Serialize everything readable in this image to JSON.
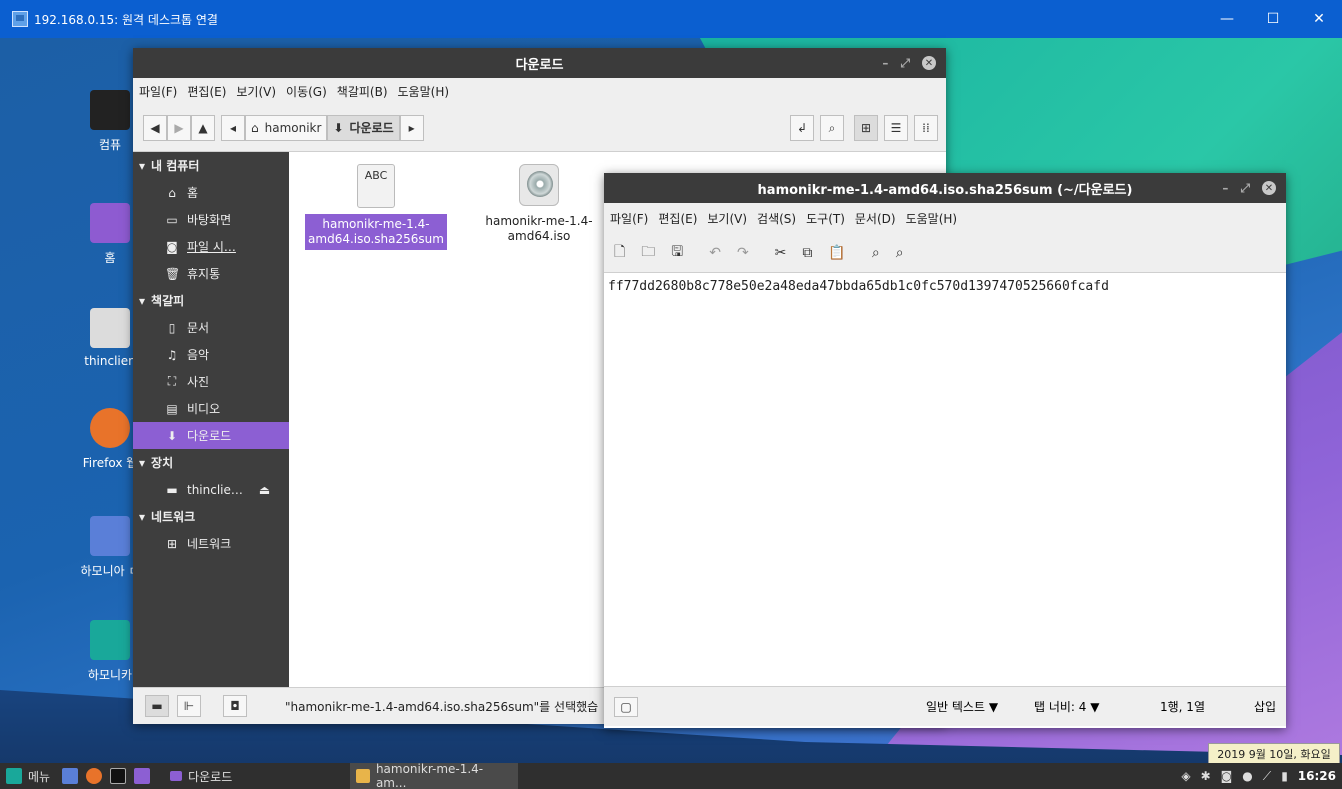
{
  "rdp": {
    "title": "192.168.0.15: 원격 데스크톱 연결",
    "min": "—",
    "max": "☐",
    "close": "✕"
  },
  "desktop_icons": [
    {
      "label": "컴퓨",
      "color": "#222"
    },
    {
      "label": "홈",
      "color": "#8e5bd1"
    },
    {
      "label": "thinclien",
      "color": "#dcdcdc"
    },
    {
      "label": "Firefox 웹",
      "color": "#e8732a"
    },
    {
      "label": "하모니아 ㅁ",
      "color": "#5a7fd8"
    },
    {
      "label": "하모니카",
      "color": "#19a89a"
    }
  ],
  "fm": {
    "title": "다운로드",
    "menu": [
      "파일(F)",
      "편집(E)",
      "보기(V)",
      "이동(G)",
      "책갈피(B)",
      "도움말(H)"
    ],
    "path_home": "hamonikr",
    "path_current": "다운로드",
    "sidebar": {
      "sec_computer": "내 컴퓨터",
      "computer_items": [
        {
          "icon": "🏠",
          "label": "홈"
        },
        {
          "icon": "▭",
          "label": "바탕화면"
        },
        {
          "icon": "◙",
          "label": "파일 시…"
        },
        {
          "icon": "🗑",
          "label": "휴지통"
        }
      ],
      "sec_bookmarks": "책갈피",
      "bookmark_items": [
        {
          "icon": "🗋",
          "label": "문서"
        },
        {
          "icon": "♫",
          "label": "음악"
        },
        {
          "icon": "⛶",
          "label": "사진"
        },
        {
          "icon": "▤",
          "label": "비디오"
        },
        {
          "icon": "⬇",
          "label": "다운로드"
        }
      ],
      "sec_devices": "장치",
      "device_item": "thinclie…",
      "sec_network": "네트워크",
      "network_item": "네트워크"
    },
    "files": [
      {
        "name_line1": "hamonikr-me-1.4-",
        "name_line2": "amd64.iso.sha256sum",
        "icon_text": "ABC"
      },
      {
        "name_line1": "hamonikr-me-1.4-",
        "name_line2": "amd64.iso"
      }
    ],
    "status": "\"hamonikr-me-1.4-amd64.iso.sha256sum\"를 선택했습"
  },
  "editor": {
    "title": "hamonikr-me-1.4-amd64.iso.sha256sum (~/다운로드)",
    "menu": [
      "파일(F)",
      "편집(E)",
      "보기(V)",
      "검색(S)",
      "도구(T)",
      "문서(D)",
      "도움말(H)"
    ],
    "content": "ff77dd2680b8c778e50e2a48eda47bbda65db1c0fc570d1397470525660fcafd",
    "status_syntax": "일반 텍스트 ▼",
    "status_tab": "탭 너비: 4 ▼",
    "status_pos": "1행, 1열",
    "status_mode": "삽입"
  },
  "taskbar": {
    "menu_label": "메뉴",
    "window1": "다운로드",
    "window2": "hamonikr-me-1.4-am...",
    "clock": "16:26",
    "tooltip": "2019 9월 10일, 화요일"
  }
}
